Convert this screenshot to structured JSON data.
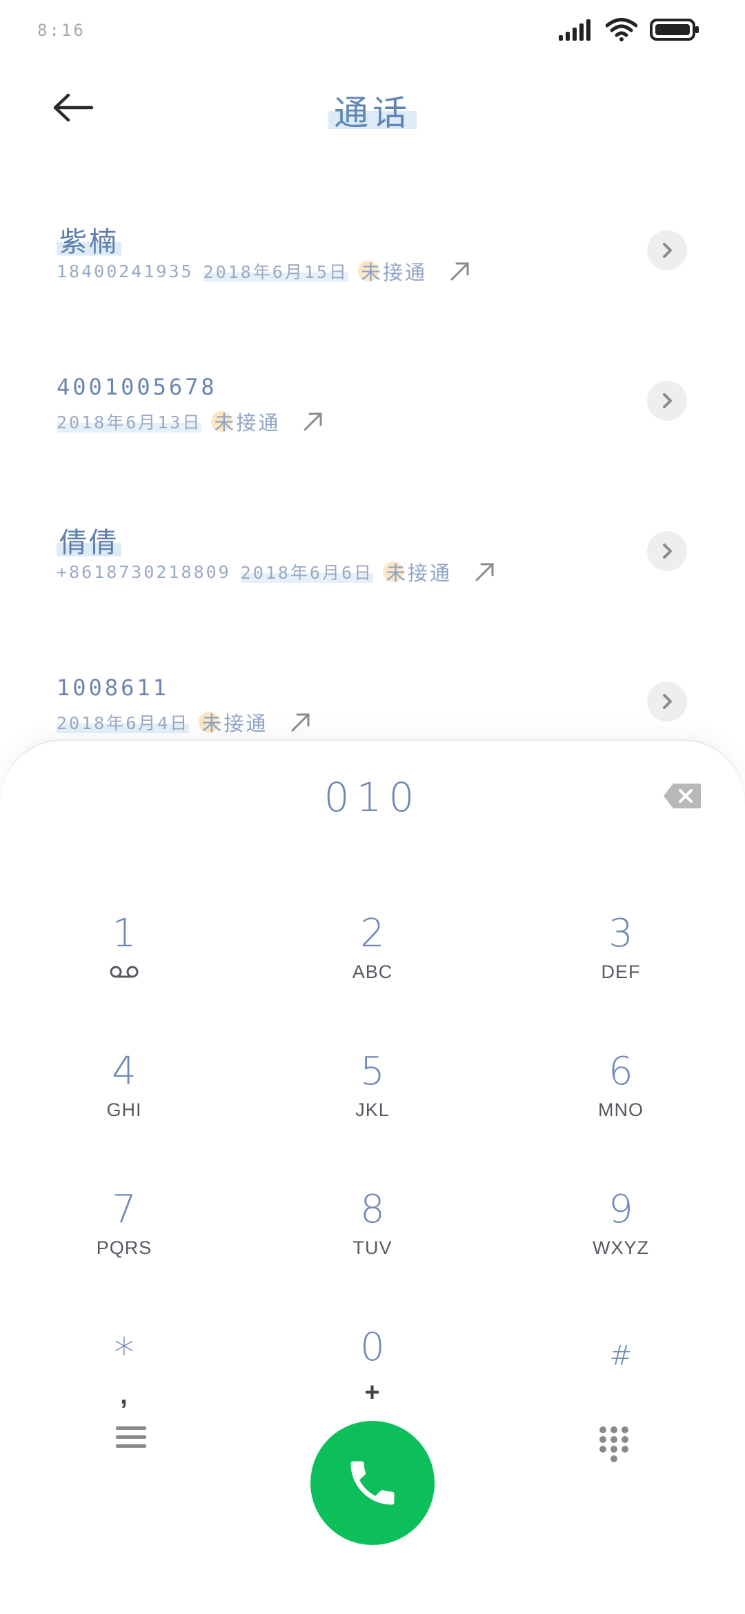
{
  "status_bar": {
    "time": "8:16",
    "icons": [
      "signal-icon",
      "wifi-icon",
      "battery-icon"
    ]
  },
  "header": {
    "title": "通话",
    "back_icon": "back-arrow-icon"
  },
  "calls": [
    {
      "name": "紫楠",
      "number": "18400241935",
      "date": "2018年6月15日",
      "status": "未接通",
      "direction_icon": "outgoing-call-icon"
    },
    {
      "name": "4001005678",
      "number": "",
      "date": "2018年6月13日",
      "status": "未接通",
      "direction_icon": "outgoing-call-icon"
    },
    {
      "name": "倩倩",
      "number": "+8618730218809",
      "date": "2018年6月6日",
      "status": "未接通",
      "direction_icon": "outgoing-call-icon"
    },
    {
      "name": "1008611",
      "number": "",
      "date": "2018年6月4日",
      "status": "未接通",
      "direction_icon": "outgoing-call-icon"
    }
  ],
  "dialer": {
    "input_value": "010",
    "keys": [
      {
        "digit": "1",
        "letters": "",
        "icon": "voicemail-icon"
      },
      {
        "digit": "2",
        "letters": "ABC"
      },
      {
        "digit": "3",
        "letters": "DEF"
      },
      {
        "digit": "4",
        "letters": "GHI"
      },
      {
        "digit": "5",
        "letters": "JKL"
      },
      {
        "digit": "6",
        "letters": "MNO"
      },
      {
        "digit": "7",
        "letters": "PQRS"
      },
      {
        "digit": "8",
        "letters": "TUV"
      },
      {
        "digit": "9",
        "letters": "WXYZ"
      },
      {
        "digit": "*",
        "letters": ","
      },
      {
        "digit": "0",
        "letters": "+"
      },
      {
        "digit": "#",
        "letters": ""
      }
    ]
  },
  "colors": {
    "call_button": "#0dbf5b",
    "accent_text": "#6f88b5"
  }
}
